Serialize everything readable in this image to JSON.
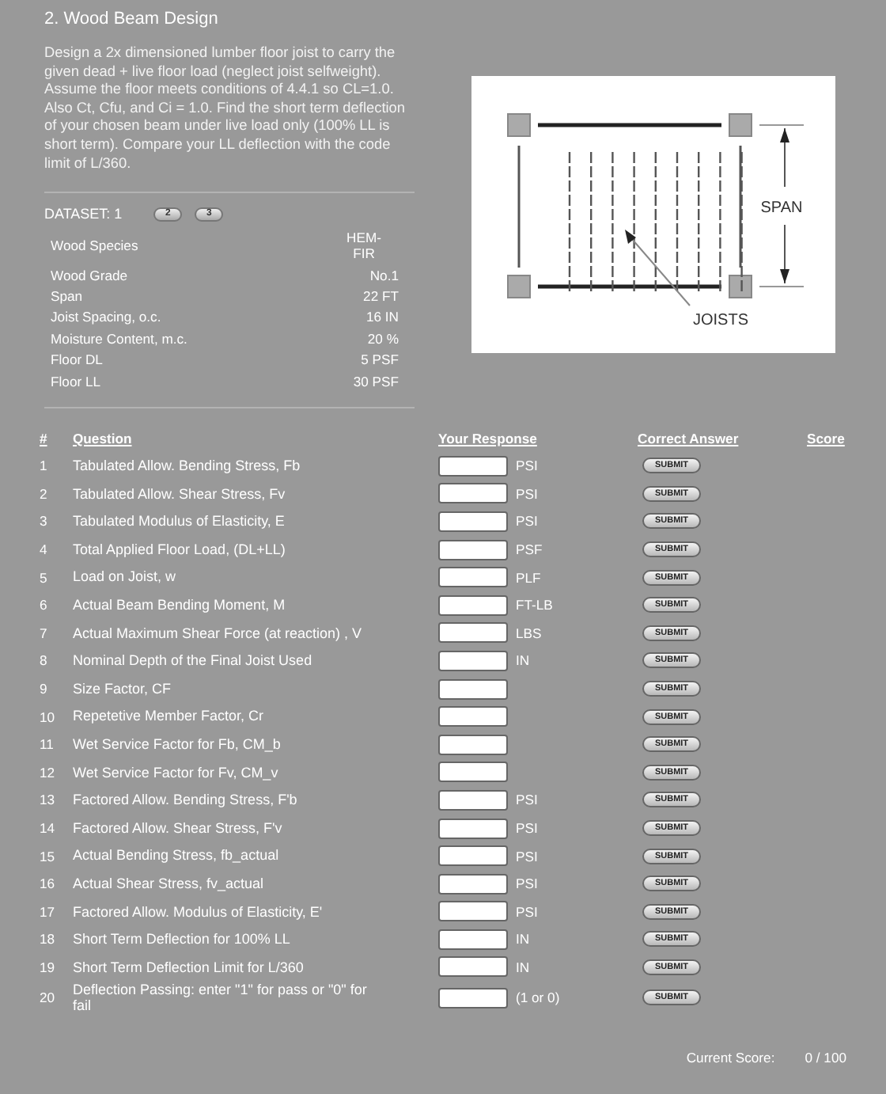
{
  "title": "2. Wood Beam Design",
  "description": "Design a 2x dimensioned lumber floor joist to carry the given dead + live floor load (neglect joist selfweight). Assume the floor meets conditions of 4.4.1 so CL=1.0. Also Ct, Cfu, and Ci = 1.0. Find the short term deflection of your chosen beam under live load only (100% LL is short term). Compare your LL deflection with the code limit of L/360.",
  "dataset": {
    "label": "DATASET: 1",
    "buttons": [
      "2",
      "3"
    ]
  },
  "parameters": [
    {
      "name": "Wood Species",
      "value": "HEM-FIR"
    },
    {
      "name": "Wood Grade",
      "value": "No.1"
    },
    {
      "name": "Span",
      "value": "22 FT"
    },
    {
      "name": "Joist Spacing, o.c.",
      "value": "16 IN"
    },
    {
      "name": "Moisture Content, m.c.",
      "value": "20 %"
    },
    {
      "name": "Floor DL",
      "value": "5 PSF"
    },
    {
      "name": "Floor LL",
      "value": "30 PSF"
    }
  ],
  "figure": {
    "span_label": "SPAN",
    "joists_label": "JOISTS"
  },
  "columns": [
    "#",
    "Question",
    "Your Response",
    "Correct Answer",
    "Score"
  ],
  "questions": [
    {
      "number": "1",
      "question": "Tabulated Allow. Bending Stress, Fb",
      "unit": "PSI",
      "button": "SUBMIT"
    },
    {
      "number": "2",
      "question": "Tabulated Allow. Shear Stress, Fv",
      "unit": "PSI",
      "button": "SUBMIT"
    },
    {
      "number": "3",
      "question": "Tabulated Modulus of Elasticity, E",
      "unit": "PSI",
      "button": "SUBMIT"
    },
    {
      "number": "4",
      "question": "Total Applied Floor Load, (DL+LL)",
      "unit": "PSF",
      "button": "SUBMIT"
    },
    {
      "number": "5",
      "question": "Load on Joist, w",
      "unit": "PLF",
      "button": "SUBMIT"
    },
    {
      "number": "6",
      "question": "Actual Beam Bending Moment, M",
      "unit": "FT-LB",
      "button": "SUBMIT"
    },
    {
      "number": "7",
      "question": "Actual Maximum Shear Force (at reaction) , V",
      "unit": "LBS",
      "button": "SUBMIT"
    },
    {
      "number": "8",
      "question": "Nominal Depth of the Final Joist Used",
      "unit": "IN",
      "button": "SUBMIT"
    },
    {
      "number": "9",
      "question": "Size Factor, CF",
      "button": "SUBMIT"
    },
    {
      "number": "10",
      "question": "Repetetive Member Factor, Cr",
      "button": "SUBMIT"
    },
    {
      "number": "11",
      "question": "Wet Service Factor for Fb, CM_b",
      "button": "SUBMIT"
    },
    {
      "number": "12",
      "question": "Wet Service Factor for Fv, CM_v",
      "button": "SUBMIT"
    },
    {
      "number": "13",
      "question": "Factored Allow. Bending Stress, F'b",
      "unit": "PSI",
      "button": "SUBMIT"
    },
    {
      "number": "14",
      "question": "Factored Allow. Shear Stress, F'v",
      "unit": "PSI",
      "button": "SUBMIT"
    },
    {
      "number": "15",
      "question": "Actual Bending Stress, fb_actual",
      "unit": "PSI",
      "button": "SUBMIT"
    },
    {
      "number": "16",
      "question": "Actual Shear Stress, fv_actual",
      "unit": "PSI",
      "button": "SUBMIT"
    },
    {
      "number": "17",
      "question": "Factored Allow. Modulus of Elasticity, E'",
      "unit": "PSI",
      "button": "SUBMIT"
    },
    {
      "number": "18",
      "question": "Short Term Deflection for 100% LL",
      "unit": "IN",
      "button": "SUBMIT"
    },
    {
      "number": "19",
      "question": "Short Term Deflection Limit for L/360",
      "unit": "IN",
      "button": "SUBMIT"
    },
    {
      "number": "20",
      "question": "Deflection Passing: enter \"1\" for pass or \"0\" for fail",
      "unit": "(1 or 0)",
      "button": "SUBMIT"
    }
  ],
  "score": {
    "label": "Current Score:",
    "value": "0 / 100"
  }
}
